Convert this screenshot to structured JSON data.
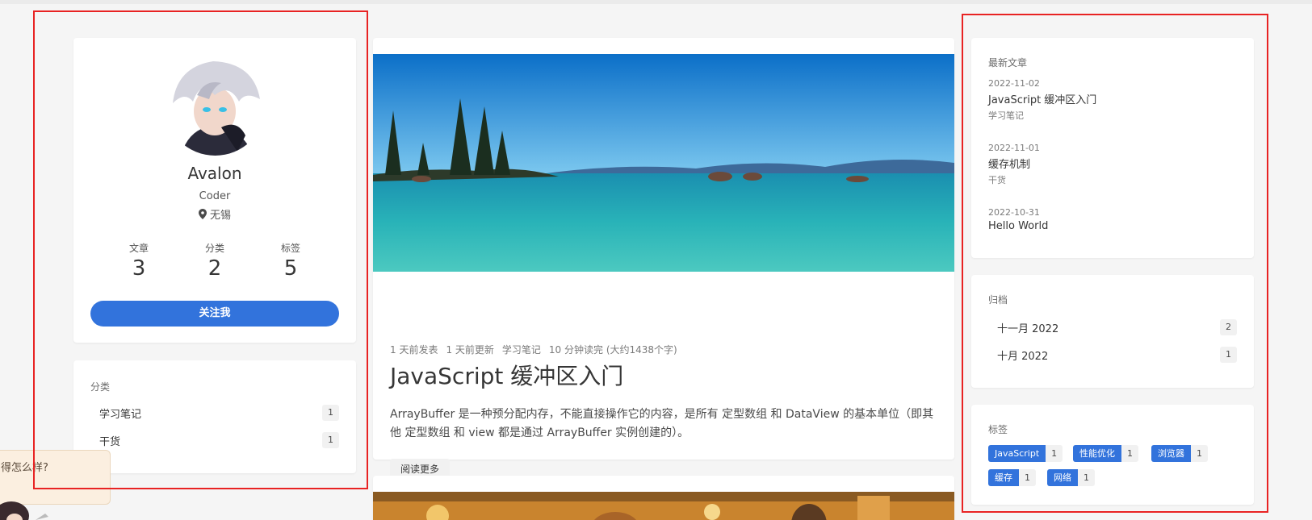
{
  "profile": {
    "name": "Avalon",
    "role": "Coder",
    "location": "无锡",
    "stats": [
      {
        "label": "文章",
        "value": "3"
      },
      {
        "label": "分类",
        "value": "2"
      },
      {
        "label": "标签",
        "value": "5"
      }
    ],
    "follow_label": "关注我"
  },
  "categories": {
    "title": "分类",
    "items": [
      {
        "label": "学习笔记",
        "count": "1"
      },
      {
        "label": "干货",
        "count": "1"
      }
    ]
  },
  "post": {
    "meta": [
      "1 天前发表",
      "1 天前更新",
      "学习笔记",
      "10 分钟读完 (大约1438个字)"
    ],
    "title": "JavaScript 缓冲区入门",
    "excerpt": "ArrayBuffer 是一种预分配内存，不能直接操作它的内容，是所有 定型数组 和 DataView 的基本单位（即其他 定型数组 和 view 都是通过 ArrayBuffer 实例创建的）。",
    "read_more": "阅读更多"
  },
  "recent": {
    "title": "最新文章",
    "items": [
      {
        "date": "2022-11-02",
        "title": "JavaScript 缓冲区入门",
        "category": "学习笔记"
      },
      {
        "date": "2022-11-01",
        "title": "缓存机制",
        "category": "干货"
      },
      {
        "date": "2022-10-31",
        "title": "Hello World",
        "category": ""
      }
    ]
  },
  "archives": {
    "title": "归档",
    "items": [
      {
        "label": "十一月 2022",
        "count": "2"
      },
      {
        "label": "十月 2022",
        "count": "1"
      }
    ]
  },
  "tags": {
    "title": "标签",
    "items": [
      {
        "name": "JavaScript",
        "count": "1"
      },
      {
        "name": "性能优化",
        "count": "1"
      },
      {
        "name": "浏览器",
        "count": "1"
      },
      {
        "name": "缓存",
        "count": "1"
      },
      {
        "name": "网络",
        "count": "1"
      }
    ]
  },
  "chat": {
    "text": "得怎么样?"
  },
  "colors": {
    "accent": "#3273dc",
    "frame": "#e82323",
    "background": "#f5f5f5"
  },
  "icons": [
    "map-marker-icon"
  ]
}
